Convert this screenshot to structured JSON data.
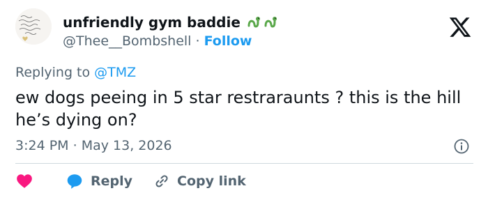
{
  "author": {
    "display_name": "unfriendly gym baddie",
    "handle": "@Thee__Bombshell",
    "separator": "·",
    "follow_label": "Follow",
    "avatar_text": [
      "well never",
      "this version of me",
      "again. Let me",
      "allow drown and be",
      "with him"
    ],
    "emoji": [
      "snake-emoji",
      "snake-emoji"
    ]
  },
  "reply_context": {
    "prefix": "Replying to",
    "mention": "@TMZ"
  },
  "tweet": {
    "text": "ew dogs peeing in 5 star restraraunts ? this is the hill he’s dying on?",
    "time": "3:24 PM",
    "separator": "·",
    "date": "May 13, 2026"
  },
  "actions": {
    "like_icon": "heart-icon",
    "reply_label": "Reply",
    "copy_label": "Copy link"
  },
  "colors": {
    "accent": "#1d9bf0",
    "like": "#f91880",
    "secondary_text": "#536471",
    "primary_text": "#0f1419",
    "divider": "#cfd9de",
    "emoji_green": "#5aa84a"
  }
}
